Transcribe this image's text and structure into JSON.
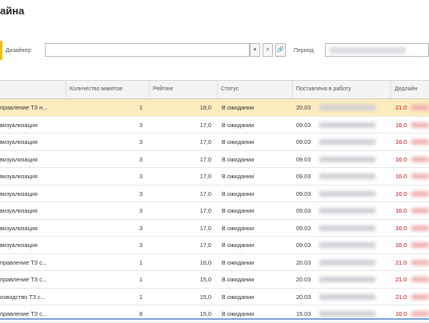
{
  "title": "айна",
  "filter": {
    "designer_label": "Дизайнер:",
    "designer_value": "",
    "dropdown_glyph": "▾",
    "clear_glyph": "×",
    "open_glyph": "🔗",
    "period_label": "Период:"
  },
  "columns": [
    "",
    "Количество макетов",
    "Рейтинг",
    "Статус",
    "Поставлена в работу",
    "Дедлайн"
  ],
  "rows": [
    {
      "name": "правление ТЗ н...",
      "count": "1",
      "rating": "18,0",
      "status": "В ожидании",
      "started": "20.03",
      "deadline": "21.0",
      "selected": true
    },
    {
      "name": "визуализация",
      "count": "3",
      "rating": "17,0",
      "status": "В ожидании",
      "started": "09.03",
      "deadline": "16.0",
      "selected": false
    },
    {
      "name": "визуализация",
      "count": "3",
      "rating": "17,0",
      "status": "В ожидании",
      "started": "09.03",
      "deadline": "16.0",
      "selected": false
    },
    {
      "name": "визуализация",
      "count": "3",
      "rating": "17,0",
      "status": "В ожидании",
      "started": "09.03",
      "deadline": "16.0",
      "selected": false
    },
    {
      "name": "визуализация",
      "count": "3",
      "rating": "17,0",
      "status": "В ожидании",
      "started": "09.03",
      "deadline": "16.0",
      "selected": false
    },
    {
      "name": "визуализация",
      "count": "3",
      "rating": "17,0",
      "status": "В ожидании",
      "started": "09.03",
      "deadline": "16.0",
      "selected": false
    },
    {
      "name": "визуализация",
      "count": "3",
      "rating": "17,0",
      "status": "В ожидании",
      "started": "09.03",
      "deadline": "16.0",
      "selected": false
    },
    {
      "name": "визуализация",
      "count": "3",
      "rating": "17,0",
      "status": "В ожидании",
      "started": "09.03",
      "deadline": "16.0",
      "selected": false
    },
    {
      "name": "визуализация",
      "count": "3",
      "rating": "17,0",
      "status": "В ожидании",
      "started": "09.03",
      "deadline": "16.0",
      "selected": false
    },
    {
      "name": "правление ТЗ с...",
      "count": "1",
      "rating": "16,0",
      "status": "В ожидании",
      "started": "20.03",
      "deadline": "21.0",
      "selected": false
    },
    {
      "name": "правление ТЗ с...",
      "count": "1",
      "rating": "15,0",
      "status": "В ожидании",
      "started": "20.03",
      "deadline": "21.0",
      "selected": false
    },
    {
      "name": "изводство ТЗ с...",
      "count": "1",
      "rating": "15,0",
      "status": "В ожидании",
      "started": "20.03",
      "deadline": "21.0",
      "selected": false
    },
    {
      "name": "правление ТЗ с...",
      "count": "8",
      "rating": "15,0",
      "status": "В ожидании",
      "started": "15.03",
      "deadline": "16.0",
      "selected": false
    }
  ]
}
